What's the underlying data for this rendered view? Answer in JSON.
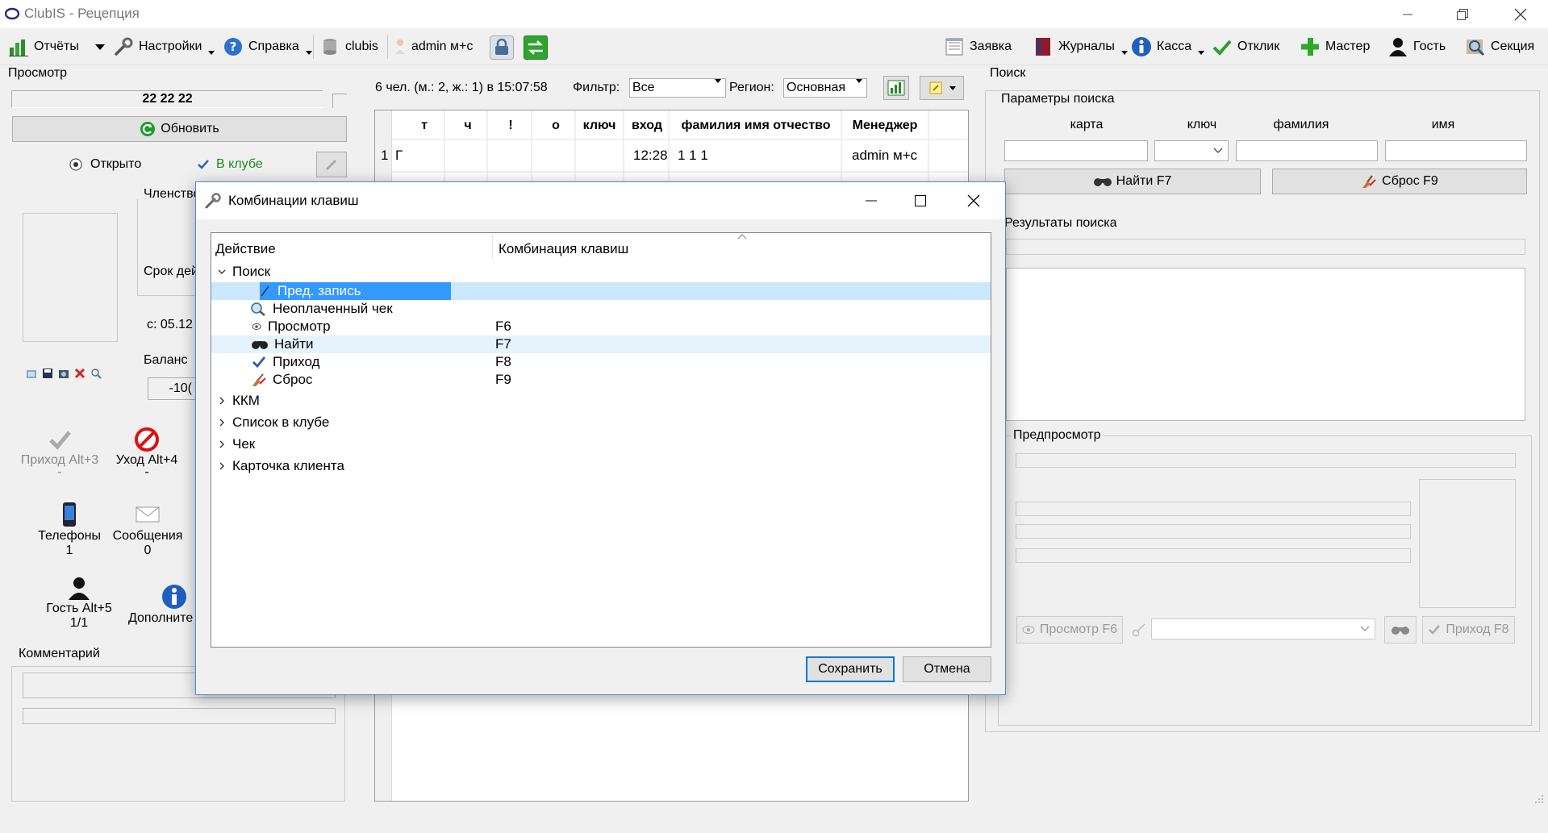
{
  "app": {
    "title": "ClubIS - Рецепция"
  },
  "toolbar": {
    "reports": "Отчёты",
    "settings": "Настройки",
    "help": "Справка",
    "db": "clubis",
    "user": "admin м+с",
    "request": "Заявка",
    "journals": "Журналы",
    "cash": "Касса",
    "response": "Отклик",
    "wizard": "Мастер",
    "guest": "Гость",
    "section": "Секция"
  },
  "left": {
    "section_title": "Просмотр",
    "card_number": "22 22 22",
    "refresh": "Обновить",
    "open": "Открыто",
    "in_club": "В клубе",
    "membership": "Членство",
    "term": "Срок дей",
    "term_from": "с:  05.12",
    "balance": "Баланс",
    "balance_value": "-10(",
    "arrival": "Приход Alt+3",
    "arrival_sub": "-",
    "leave": "Уход Alt+4",
    "leave_sub": "-",
    "phones": "Телефоны",
    "phones_count": "1",
    "messages": "Сообщения",
    "messages_count": "0",
    "guest": "Гость Alt+5",
    "guest_count": "1/1",
    "extra": "Дополните",
    "comment": "Комментарий"
  },
  "center": {
    "summary": "6 чел. (м.: 2, ж.: 1) в 15:07:58",
    "filter_label": "Фильтр:",
    "filter_value": "Все",
    "region_label": "Регион:",
    "region_value": "Основная",
    "columns": [
      "т",
      "ч",
      "!",
      "о",
      "ключ",
      "вход",
      "фамилия имя отчество",
      "Менеджер"
    ],
    "row": {
      "num": "1",
      "t": "Г",
      "time": "12:28",
      "name": "1 1 1",
      "manager": "admin м+с"
    }
  },
  "right": {
    "section_title": "Поиск",
    "params_title": "Параметры поиска",
    "col_card": "карта",
    "col_key": "ключ",
    "col_surname": "фамилия",
    "col_name": "имя",
    "find": "Найти F7",
    "reset": "Сброс F9",
    "results_title": "Результаты поиска",
    "preview_title": "Предпросмотр",
    "view_btn": "Просмотр F6",
    "arrival_btn": "Приход F8"
  },
  "dialog": {
    "title": "Комбинации клавиш",
    "col_action": "Действие",
    "col_keys": "Комбинация клавиш",
    "group_search": "Поиск",
    "items": [
      {
        "label": "Пред. запись",
        "keys": ""
      },
      {
        "label": "Неоплаченный чек",
        "keys": ""
      },
      {
        "label": "Просмотр",
        "keys": "F6"
      },
      {
        "label": "Найти",
        "keys": "F7"
      },
      {
        "label": "Приход",
        "keys": "F8"
      },
      {
        "label": "Сброс",
        "keys": "F9"
      }
    ],
    "groups": [
      "ККМ",
      "Список в клубе",
      "Чек",
      "Карточка клиента"
    ],
    "save": "Сохранить",
    "cancel": "Отмена"
  },
  "colors": {
    "selection": "#3399ff",
    "row_highlight": "#cce8ff",
    "accent_green": "#1a9a2a",
    "dialog_border": "#4a8bd6"
  }
}
